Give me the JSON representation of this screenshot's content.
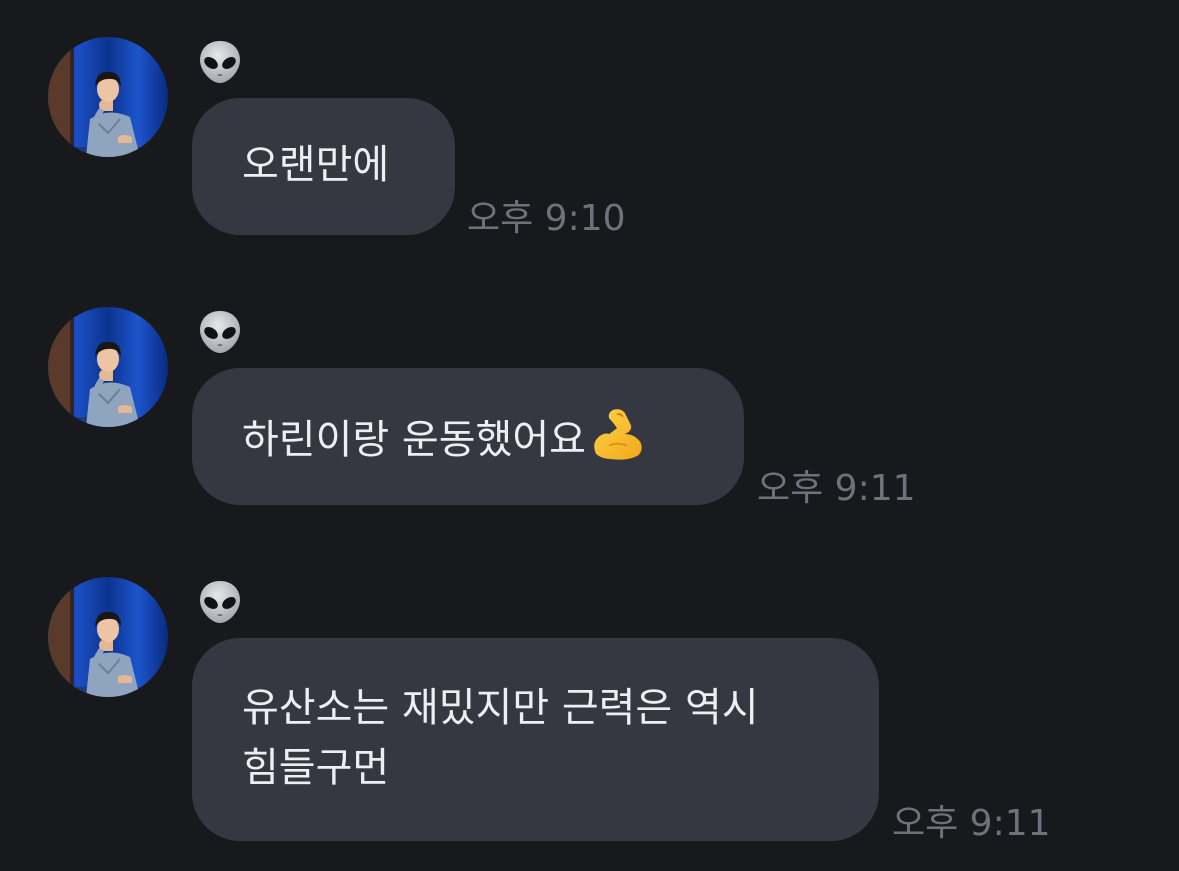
{
  "messages": [
    {
      "sender_icon": "alien-emoji",
      "avatar": "profile-photo",
      "text": "오랜만에",
      "time": "오후 9:10"
    },
    {
      "sender_icon": "alien-emoji",
      "avatar": "profile-photo",
      "text": "하린이랑 운동했어요",
      "emoji": "flexed-biceps",
      "time": "오후 9:11"
    },
    {
      "sender_icon": "alien-emoji",
      "avatar": "profile-photo",
      "text_line1": "유산소는 재밌지만 근력은 역시",
      "text_line2": "힘들구먼",
      "time": "오후 9:11"
    }
  ],
  "colors": {
    "background": "#18191d",
    "bubble": "#353840",
    "text": "#eceef2",
    "timestamp": "#6f727a"
  }
}
